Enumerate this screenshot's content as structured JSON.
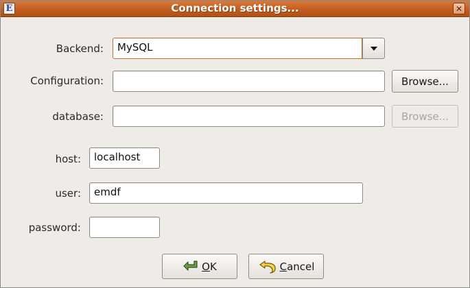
{
  "window": {
    "title": "Connection settings...",
    "app_icon_letter": "E"
  },
  "backend": {
    "label": "Backend:",
    "value": "MySQL"
  },
  "configuration": {
    "label": "Configuration:",
    "value": "",
    "browse_label": "Browse..."
  },
  "database": {
    "label": "database:",
    "value": "",
    "browse_label": "Browse..."
  },
  "host": {
    "label": "host:",
    "value": "localhost"
  },
  "user": {
    "label": "user:",
    "value": "emdf"
  },
  "password": {
    "label": "password:",
    "value": ""
  },
  "buttons": {
    "ok": {
      "mnemonic": "O",
      "rest": "K"
    },
    "cancel": {
      "mnemonic": "C",
      "rest": "ancel"
    }
  },
  "colors": {
    "titlebar": "#c45e1f",
    "window_bg": "#efebe7",
    "focus_border": "#c96a2a"
  }
}
